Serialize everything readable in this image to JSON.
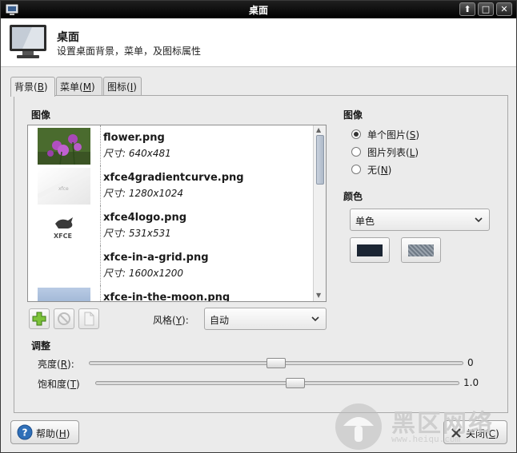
{
  "window": {
    "title": "桌面",
    "buttons": {
      "up": "⬆",
      "maximize": "□",
      "close": "✕"
    }
  },
  "header": {
    "title": "桌面",
    "subtitle": "设置桌面背景，菜单，及图标属性"
  },
  "tabs": [
    {
      "label": "背景(",
      "mnemonic": "B",
      "suffix": ")",
      "active": true
    },
    {
      "label": "菜单(",
      "mnemonic": "M",
      "suffix": ")",
      "active": false
    },
    {
      "label": "图标(",
      "mnemonic": "I",
      "suffix": ")",
      "active": false
    }
  ],
  "background": {
    "image_section_label": "图像",
    "images": [
      {
        "name": "flower.png",
        "size": "尺寸:  640x481",
        "thumb": "flower-photo"
      },
      {
        "name": "xfce4gradientcurve.png",
        "size": "尺寸:  1280x1024",
        "thumb": "gradient-curve"
      },
      {
        "name": "xfce4logo.png",
        "size": "尺寸:  531x531",
        "thumb": "xfce-logo"
      },
      {
        "name": "xfce-in-a-grid.png",
        "size": "尺寸:  1600x1200",
        "thumb": "blank"
      },
      {
        "name": "xfce-in-the-moon.png",
        "size": "",
        "thumb": "moon-sky"
      }
    ],
    "style_label": "风格(",
    "style_mnemonic": "Y",
    "style_suffix": "):",
    "style_value": "自动",
    "adjust_label": "调整",
    "brightness_label": "亮度(",
    "brightness_mnemonic": "R",
    "brightness_suffix": "):",
    "brightness_value": "0",
    "brightness_level": 0.5,
    "saturation_label": "饱和度(",
    "saturation_mnemonic": "T",
    "saturation_suffix": ")",
    "saturation_value": "1.0",
    "saturation_level": 0.55,
    "right_image_label": "图像",
    "radios": [
      {
        "label": "单个图片(",
        "mnemonic": "S",
        "suffix": ")",
        "checked": true
      },
      {
        "label": "图片列表(",
        "mnemonic": "L",
        "suffix": ")",
        "checked": false
      },
      {
        "label": "无(",
        "mnemonic": "N",
        "suffix": ")",
        "checked": false
      }
    ],
    "color_label": "颜色",
    "color_style_value": "单色",
    "color1": "#1b2533",
    "color2": "#6f7a86"
  },
  "footer": {
    "help_label": "帮助(",
    "help_mnemonic": "H",
    "help_suffix": ")",
    "close_label": "关闭(",
    "close_mnemonic": "C",
    "close_suffix": ")"
  },
  "watermark": {
    "big": "黑区网络",
    "small": "www.heiqu.com"
  }
}
